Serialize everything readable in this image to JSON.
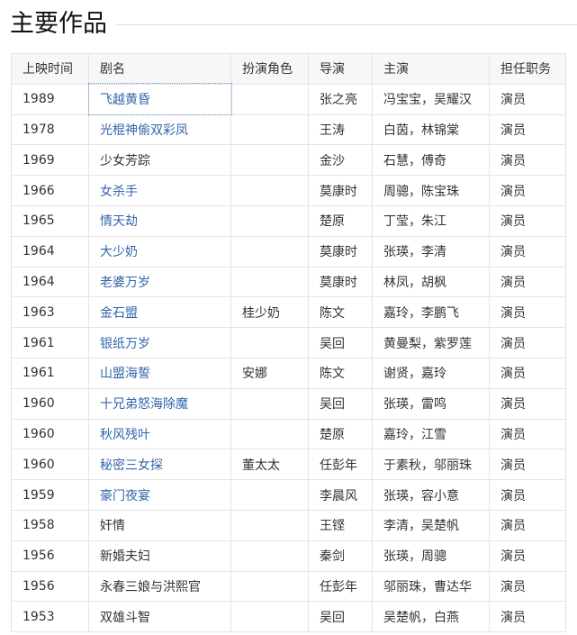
{
  "page": {
    "title": "主要作品"
  },
  "table": {
    "columns": [
      "上映时间",
      "剧名",
      "扮演角色",
      "导演",
      "主演",
      "担任职务"
    ],
    "rows": [
      {
        "year": "1989",
        "title": "飞越黄昏",
        "role": "",
        "director": "张之亮",
        "cast": "冯宝宝，吴耀汉",
        "job": "演员",
        "link": true
      },
      {
        "year": "1978",
        "title": "光棍神偷双彩凤",
        "role": "",
        "director": "王涛",
        "cast": "白茵，林锦棠",
        "job": "演员",
        "link": true
      },
      {
        "year": "1969",
        "title": "少女芳踪",
        "role": "",
        "director": "金沙",
        "cast": "石慧，傅奇",
        "job": "演员",
        "link": false
      },
      {
        "year": "1966",
        "title": "女杀手",
        "role": "",
        "director": "莫康时",
        "cast": "周骢，陈宝珠",
        "job": "演员",
        "link": true
      },
      {
        "year": "1965",
        "title": "情天劫",
        "role": "",
        "director": "楚原",
        "cast": "丁莹，朱江",
        "job": "演员",
        "link": true
      },
      {
        "year": "1964",
        "title": "大少奶",
        "role": "",
        "director": "莫康时",
        "cast": "张瑛，李清",
        "job": "演员",
        "link": true
      },
      {
        "year": "1964",
        "title": "老婆万岁",
        "role": "",
        "director": "莫康时",
        "cast": "林凤，胡枫",
        "job": "演员",
        "link": true
      },
      {
        "year": "1963",
        "title": "金石盟",
        "role": "桂少奶",
        "director": "陈文",
        "cast": "嘉玲，李鹏飞",
        "job": "演员",
        "link": true
      },
      {
        "year": "1961",
        "title": "银纸万岁",
        "role": "",
        "director": "吴回",
        "cast": "黄曼梨，紫罗莲",
        "job": "演员",
        "link": true
      },
      {
        "year": "1961",
        "title": "山盟海誓",
        "role": "安娜",
        "director": "陈文",
        "cast": "谢贤，嘉玲",
        "job": "演员",
        "link": true
      },
      {
        "year": "1960",
        "title": "十兄弟怒海除魔",
        "role": "",
        "director": "吴回",
        "cast": "张瑛，雷鸣",
        "job": "演员",
        "link": true
      },
      {
        "year": "1960",
        "title": "秋风残叶",
        "role": "",
        "director": "楚原",
        "cast": "嘉玲，江雪",
        "job": "演员",
        "link": true
      },
      {
        "year": "1960",
        "title": "秘密三女探",
        "role": "董太太",
        "director": "任彭年",
        "cast": "于素秋，邬丽珠",
        "job": "演员",
        "link": true
      },
      {
        "year": "1959",
        "title": "豪门夜宴",
        "role": "",
        "director": "李晨风",
        "cast": "张瑛，容小意",
        "job": "演员",
        "link": true
      },
      {
        "year": "1958",
        "title": "奸情",
        "role": "",
        "director": "王铿",
        "cast": "李清，吴楚帆",
        "job": "演员",
        "link": false
      },
      {
        "year": "1956",
        "title": "新婚夫妇",
        "role": "",
        "director": "秦剑",
        "cast": "张瑛，周骢",
        "job": "演员",
        "link": false
      },
      {
        "year": "1956",
        "title": "永春三娘与洪熙官",
        "role": "",
        "director": "任彭年",
        "cast": "邬丽珠，曹达华",
        "job": "演员",
        "link": false
      },
      {
        "year": "1953",
        "title": "双雄斗智",
        "role": "",
        "director": "吴回",
        "cast": "吴楚帆，白燕",
        "job": "演员",
        "link": false
      }
    ]
  },
  "colors": {
    "link": "#3366aa",
    "header_bg": "#f7f7f7",
    "border": "#e4e4e4"
  }
}
